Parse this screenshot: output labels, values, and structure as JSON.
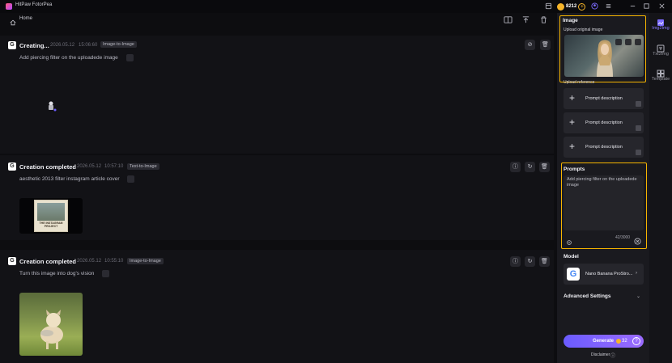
{
  "app": {
    "title": "HitPaw FotorPea",
    "credits": "8212"
  },
  "nav": {
    "home_label": "Home"
  },
  "cards": [
    {
      "status": "Creating...",
      "date": "2026.05.12",
      "time": "15:06:60",
      "tag": "Image-to-Image",
      "prompt": "Add piercing filter on the uploadede image"
    },
    {
      "status": "Creation completed",
      "date": "2026.05.12",
      "time": "10:57:10",
      "tag": "Text-to-Image",
      "prompt": "aesthetic 2013 filter instagram article cover",
      "thumb_text": "THE INSTAGRAM PROJECT"
    },
    {
      "status": "Creation completed",
      "date": "2026.05.12",
      "time": "10:55:10",
      "tag": "Image-to-Image",
      "prompt": "Turn this image into dog's vision"
    }
  ],
  "panel": {
    "image": {
      "title": "Image",
      "upload_label": "Upload original image"
    },
    "reference": {
      "label": "Upload reference",
      "rows": [
        "Prompt description",
        "Prompt description",
        "Prompt description"
      ]
    },
    "prompts": {
      "title": "Prompts",
      "text": "Add piercing filter on the uploadede image",
      "counter": "42/3000"
    },
    "model": {
      "title": "Model",
      "name": "Nano Banana ProStro..."
    },
    "advanced": {
      "title": "Advanced Settings"
    },
    "generate": {
      "label": "Generate",
      "cost": "32"
    },
    "disclaimer": "Disclaimer"
  },
  "rail": [
    {
      "label": "Img2Img",
      "icon": "image-edit-icon",
      "active": true
    },
    {
      "label": "Txt2Img",
      "icon": "text-image-icon",
      "active": false
    },
    {
      "label": "Template",
      "icon": "template-grid-icon",
      "active": false
    }
  ],
  "colors": {
    "accent": "#7b6bff",
    "highlight": "#f7b500",
    "coin": "#f5b429"
  }
}
